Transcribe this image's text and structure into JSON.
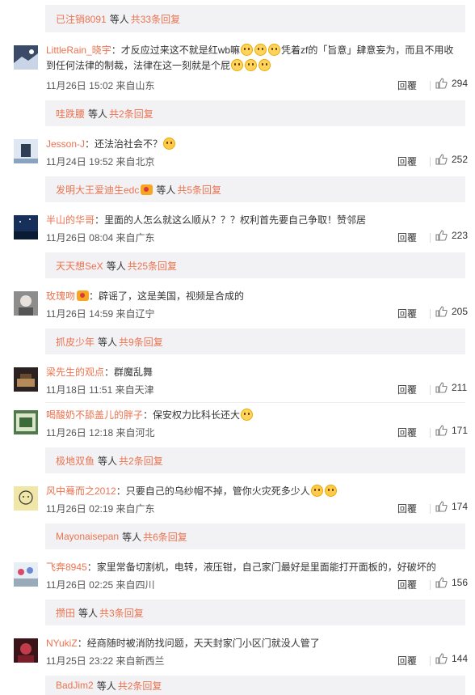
{
  "accent_color": "#eb7350",
  "top_reply": {
    "user": "已注销8091",
    "label": "等人",
    "count": "共33条回复"
  },
  "comments": [
    {
      "user": "LittleRain_晓宇",
      "text_line1_a": "：才反应过来这不就是红wb嘛",
      "text_line1_b": "凭着zf的「旨意」肆意妄为，而且不用收",
      "text_line2": "到任何法律的制裁，法律在这一刻就是个屁",
      "time": "11月26日 15:02 来自山东",
      "reply_label": "回覆",
      "likes": "294",
      "reply_bar": {
        "user": "哇跌腰",
        "label": "等人",
        "count": "共2条回复"
      }
    },
    {
      "user": "Jesson-J",
      "text": "：还法治社会不？",
      "time": "11月24日 19:52 来自北京",
      "reply_label": "回覆",
      "likes": "252",
      "reply_bar": {
        "user": "发明大王爱迪生edc",
        "label": "等人",
        "count": "共5条回复"
      }
    },
    {
      "user": "半山的华哥",
      "text": "：里面的人怎么就这么顺从？？？权利首先要自己争取！赞邻居",
      "time": "11月26日 08:04 来自广东",
      "reply_label": "回覆",
      "likes": "223",
      "reply_bar": {
        "user": "天天想SeX",
        "label": "等人",
        "count": "共25条回复"
      }
    },
    {
      "user": "玫瑰吻",
      "text": "：辟谣了，这是美国，视频是合成的",
      "time": "11月26日 14:59 来自辽宁",
      "reply_label": "回覆",
      "likes": "205",
      "reply_bar": {
        "user": "抓皮少年",
        "label": "等人",
        "count": "共9条回复"
      }
    },
    {
      "user": "梁先生的观点",
      "text": "：群魔乱舞",
      "time": "11月18日 11:51 来自天津",
      "reply_label": "回覆",
      "likes": "211"
    },
    {
      "user": "喝酸奶不舔盖儿的胖子",
      "text": "：保安权力比科长还大",
      "time": "11月26日 12:18 来自河北",
      "reply_label": "回覆",
      "likes": "171",
      "reply_bar": {
        "user": "极地双鱼",
        "label": "等人",
        "count": "共2条回复"
      }
    },
    {
      "user": "风中蓦而之2012",
      "text": "：只要自己的乌纱帽不掉，管你火灾死多少人",
      "time": "11月26日 02:19 来自广东",
      "reply_label": "回覆",
      "likes": "174",
      "reply_bar": {
        "user": "Mayonaisepan",
        "label": "等人",
        "count": "共6条回复"
      }
    },
    {
      "user": "飞奔8945",
      "text": "：家里常备切割机，电转，液压钳，自己家门最好是里面能打开面板的，好破坏的",
      "time": "11月26日 02:25 来自四川",
      "reply_label": "回覆",
      "likes": "156",
      "reply_bar": {
        "user": "攒田",
        "label": "等人",
        "count": "共3条回复"
      }
    },
    {
      "user": "NYukiZ",
      "text": "：经商随时被消防找问题，天天封家门小区门就没人管了",
      "time": "11月25日 23:22 来自新西兰",
      "reply_label": "回覆",
      "likes": "144",
      "reply_bar": {
        "user": "BadJim2",
        "label": "等人",
        "count": "共2条回复"
      }
    }
  ]
}
